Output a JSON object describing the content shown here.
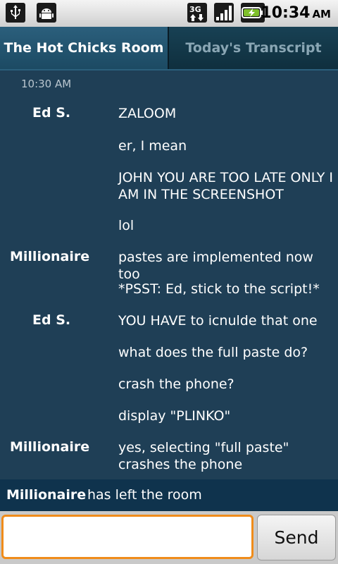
{
  "status_bar": {
    "icons": [
      "usb-icon",
      "android-debug-icon",
      "3g-data-icon",
      "signal-icon",
      "battery-charging-icon"
    ],
    "network_label": "3G",
    "time": "10:34",
    "ampm": "AM"
  },
  "tabs": [
    {
      "label": "The Hot Chicks Room",
      "active": true
    },
    {
      "label": "Today's Transcript",
      "active": false
    }
  ],
  "chat": {
    "timestamp": "10:30 AM",
    "messages": [
      {
        "sender": "Ed S.",
        "text": "ZALOOM"
      },
      {
        "sender": "",
        "text": "er, I mean"
      },
      {
        "sender": "",
        "text": "JOHN YOU ARE TOO LATE ONLY I AM IN THE SCREENSHOT"
      },
      {
        "sender": "",
        "text": "lol"
      },
      {
        "sender": "Millionaire",
        "text": "pastes are implemented now too"
      },
      {
        "sender": "",
        "text": "*PSST: Ed, stick to the script!*"
      },
      {
        "sender": "Ed S.",
        "text": "YOU HAVE to icnulde that one"
      },
      {
        "sender": "",
        "text": "what does the full paste do?"
      },
      {
        "sender": "",
        "text": "crash the phone?"
      },
      {
        "sender": "",
        "text": "display \"PLINKO\""
      },
      {
        "sender": "Millionaire",
        "text": "yes, selecting \"full paste\" crashes the phone"
      }
    ]
  },
  "notice": {
    "who": "Millionaire",
    "what": "has left the room"
  },
  "composer": {
    "value": "",
    "placeholder": "",
    "send_label": "Send"
  },
  "colors": {
    "background": "#1f3f56",
    "notice_bar": "#0f334d",
    "input_focus": "#f08c1a"
  }
}
